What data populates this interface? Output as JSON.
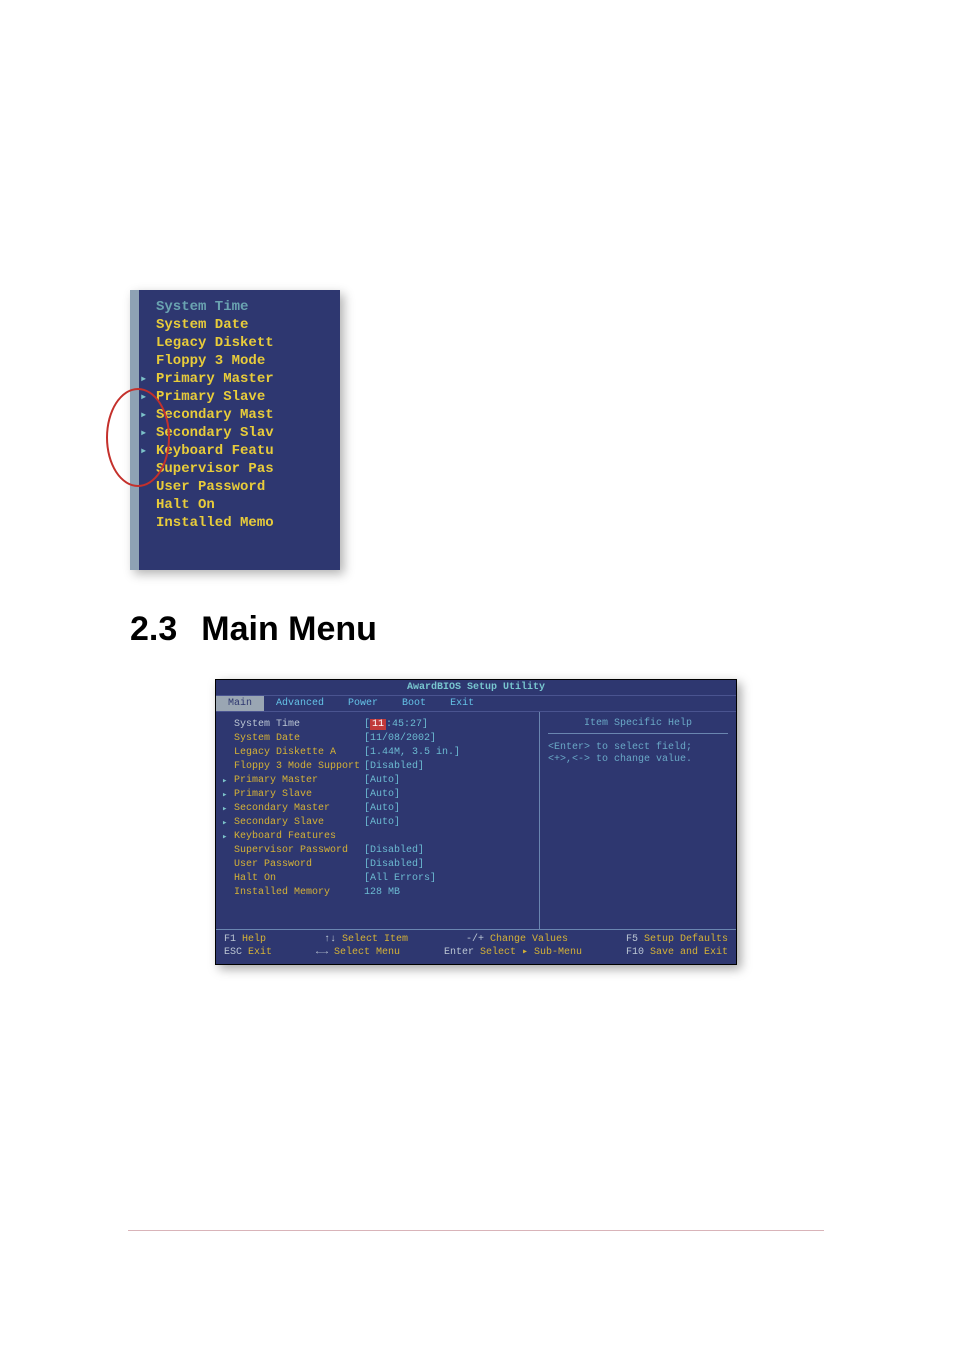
{
  "snippet": {
    "lines": [
      {
        "text": "System Time",
        "dim": true,
        "arrow": false
      },
      {
        "text": "System Date",
        "dim": false,
        "arrow": false
      },
      {
        "text": "Legacy Diskett",
        "dim": false,
        "arrow": false
      },
      {
        "text": "Floppy 3 Mode",
        "dim": false,
        "arrow": false
      },
      {
        "text": "",
        "dim": false,
        "arrow": false
      },
      {
        "text": "Primary Master",
        "dim": false,
        "arrow": true
      },
      {
        "text": "Primary Slave",
        "dim": false,
        "arrow": true
      },
      {
        "text": "Secondary Mast",
        "dim": false,
        "arrow": true
      },
      {
        "text": "Secondary Slav",
        "dim": false,
        "arrow": true
      },
      {
        "text": "Keyboard Featu",
        "dim": false,
        "arrow": true
      },
      {
        "text": "Supervisor Pas",
        "dim": false,
        "arrow": false
      },
      {
        "text": "User Password",
        "dim": false,
        "arrow": false
      },
      {
        "text": "Halt On",
        "dim": false,
        "arrow": false
      },
      {
        "text": "Installed Memo",
        "dim": false,
        "arrow": false
      }
    ]
  },
  "section": {
    "number": "2.3",
    "title": "Main Menu"
  },
  "bios": {
    "title": "AwardBIOS Setup Utility",
    "menus": [
      {
        "label": "Main",
        "active": true
      },
      {
        "label": "Advanced",
        "active": false
      },
      {
        "label": "Power",
        "active": false
      },
      {
        "label": "Boot",
        "active": false
      },
      {
        "label": "Exit",
        "active": false
      }
    ],
    "help": {
      "title": "Item Specific Help",
      "lines": [
        "<Enter> to select field;",
        "<+>,<-> to change value."
      ]
    },
    "rows": [
      {
        "label": "System Time",
        "value_type": "time",
        "value": "11:45:27",
        "arrow": false,
        "selected": true
      },
      {
        "label": "System Date",
        "value_type": "plain",
        "value": "[11/08/2002]",
        "arrow": false,
        "selected": false
      },
      {
        "label": "Legacy Diskette A",
        "value_type": "plain",
        "value": "[1.44M, 3.5 in.]",
        "arrow": false,
        "selected": false
      },
      {
        "label": "Floppy 3 Mode Support",
        "value_type": "plain",
        "value": "[Disabled]",
        "arrow": false,
        "selected": false
      },
      {
        "label": "",
        "value_type": "blank",
        "value": "",
        "arrow": false,
        "selected": false
      },
      {
        "label": "Primary Master",
        "value_type": "plain",
        "value": "[Auto]",
        "arrow": true,
        "selected": false
      },
      {
        "label": "Primary Slave",
        "value_type": "plain",
        "value": "[Auto]",
        "arrow": true,
        "selected": false
      },
      {
        "label": "Secondary Master",
        "value_type": "plain",
        "value": "[Auto]",
        "arrow": true,
        "selected": false
      },
      {
        "label": "Secondary Slave",
        "value_type": "plain",
        "value": "[Auto]",
        "arrow": true,
        "selected": false
      },
      {
        "label": "Keyboard Features",
        "value_type": "plain",
        "value": "",
        "arrow": true,
        "selected": false
      },
      {
        "label": "Supervisor Password",
        "value_type": "plain",
        "value": "[Disabled]",
        "arrow": false,
        "selected": false
      },
      {
        "label": "User Password",
        "value_type": "plain",
        "value": "[Disabled]",
        "arrow": false,
        "selected": false
      },
      {
        "label": "Halt On",
        "value_type": "plain",
        "value": "[All Errors]",
        "arrow": false,
        "selected": false
      },
      {
        "label": "Installed Memory",
        "value_type": "plain",
        "value": "128 MB",
        "arrow": false,
        "selected": false
      }
    ],
    "time_parts": {
      "hh": "11",
      "mm": "45",
      "ss": "27"
    },
    "footer": {
      "row1": [
        {
          "key": "F1",
          "label": "Help"
        },
        {
          "key": "↑↓",
          "label": "Select Item"
        },
        {
          "key": "-/+",
          "label": "Change Values"
        },
        {
          "key": "F5",
          "label": "Setup Defaults"
        }
      ],
      "row2": [
        {
          "key": "ESC",
          "label": "Exit"
        },
        {
          "key": "←→",
          "label": "Select Menu"
        },
        {
          "key": "Enter",
          "label": "Select ▸ Sub-Menu"
        },
        {
          "key": "F10",
          "label": "Save and Exit"
        }
      ]
    }
  }
}
